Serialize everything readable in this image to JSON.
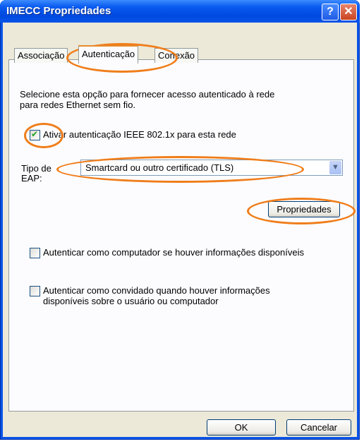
{
  "window": {
    "title": "IMECC Propriedades",
    "help_glyph": "?",
    "close_glyph": "✕"
  },
  "tabs": [
    {
      "label": "Associação",
      "active": false
    },
    {
      "label": "Autenticação",
      "active": true
    },
    {
      "label": "Conexão",
      "active": false
    }
  ],
  "content": {
    "description_line1": "Selecione esta opção para fornecer acesso autenticado à rede",
    "description_line2": "para redes Ethernet sem fio.",
    "enable_8021x": {
      "label": "Ativar autenticação IEEE 802.1x para esta rede",
      "checked": true
    },
    "eap_type_label_line1": "Tipo de",
    "eap_type_label_line2": "EAP:",
    "eap_type_value": "Smartcard ou outro certificado (TLS)",
    "properties_button": "Propriedades",
    "auth_as_computer": {
      "label": "Autenticar como computador se houver informações disponíveis",
      "checked": false
    },
    "auth_as_guest_line1": "Autenticar como convidado quando houver informações",
    "auth_as_guest_line2": "disponíveis sobre o usuário ou computador",
    "auth_as_guest_checked": false
  },
  "footer": {
    "ok_label": "OK",
    "cancel_label": "Cancelar"
  },
  "colors": {
    "titlebar": "#0a55e8",
    "highlight_ring": "#f07d1a",
    "dialog_bg": "#ece9d8"
  }
}
